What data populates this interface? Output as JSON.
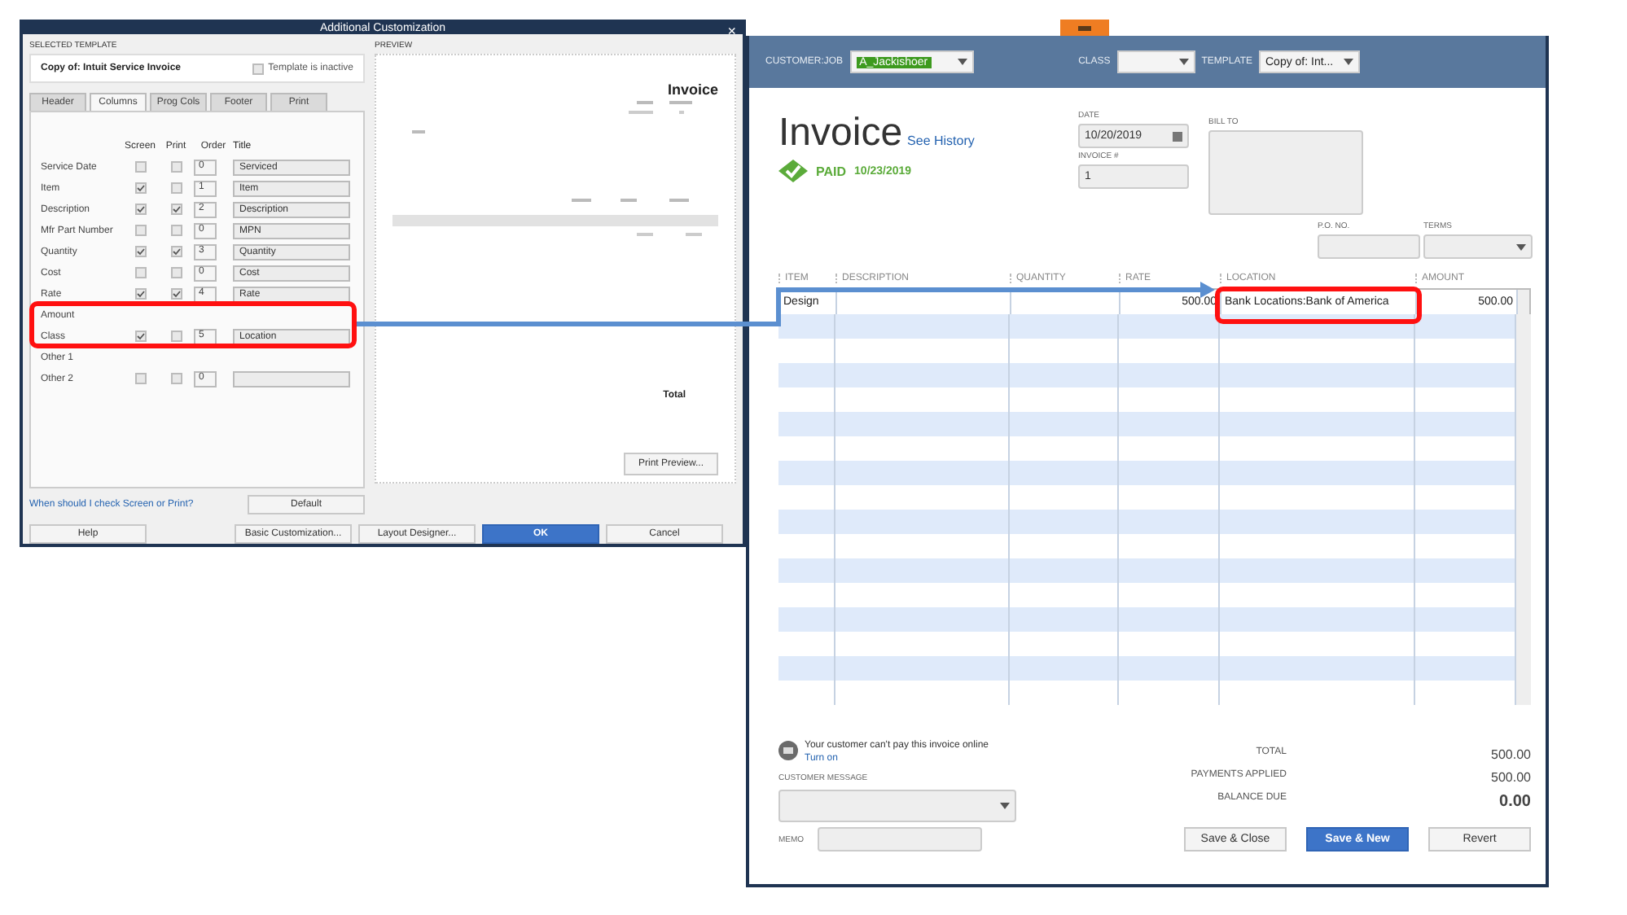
{
  "dialog": {
    "title": "Additional Customization",
    "close": "×",
    "selected_template_label": "SELECTED TEMPLATE",
    "template_name": "Copy of: Intuit Service Invoice",
    "inactive": {
      "label": "Template is inactive",
      "checked": false
    },
    "tabs": [
      {
        "label": "Header",
        "selected": false
      },
      {
        "label": "Columns",
        "selected": true
      },
      {
        "label": "Prog Cols",
        "selected": false
      },
      {
        "label": "Footer",
        "selected": false
      },
      {
        "label": "Print",
        "selected": false
      }
    ],
    "column_headers": [
      "Screen",
      "Print",
      "Order",
      "Title"
    ],
    "rows": [
      {
        "label": "Service Date",
        "screen": false,
        "print": false,
        "order": "0",
        "title": "Serviced"
      },
      {
        "label": "Item",
        "screen": true,
        "print": false,
        "order": "1",
        "title": "Item"
      },
      {
        "label": "Description",
        "screen": true,
        "print": true,
        "order": "2",
        "title": "Description"
      },
      {
        "label": "Mfr Part Number",
        "screen": false,
        "print": false,
        "order": "0",
        "title": "MPN"
      },
      {
        "label": "Quantity",
        "screen": true,
        "print": true,
        "order": "3",
        "title": "Quantity"
      },
      {
        "label": "Cost",
        "screen": false,
        "print": false,
        "order": "0",
        "title": "Cost"
      },
      {
        "label": "Rate",
        "screen": true,
        "print": true,
        "order": "4",
        "title": "Rate"
      },
      {
        "label": "Amount"
      },
      {
        "label": "Class",
        "screen": true,
        "print": false,
        "order": "5",
        "title": "Location"
      },
      {
        "label": "Other 1"
      },
      {
        "label": "Other 2",
        "screen": false,
        "print": false,
        "order": "0"
      }
    ],
    "help_link": "When should I check Screen or Print?",
    "default_button": "Default",
    "preview": {
      "label": "PREVIEW",
      "doc_title": "Invoice",
      "total_label": "Total",
      "button": "Print Preview..."
    },
    "buttons": [
      {
        "label": "Help",
        "primary": false
      },
      {
        "label": "Basic Customization...",
        "primary": false
      },
      {
        "label": "Layout Designer...",
        "primary": false
      },
      {
        "label": "OK",
        "primary": true
      },
      {
        "label": "Cancel",
        "primary": false
      }
    ]
  },
  "invoice": {
    "customer_label": "CUSTOMER:JOB",
    "customer": "A_Jackishoer",
    "class_label": "CLASS",
    "template_label": "TEMPLATE",
    "template": "Copy of: Int...",
    "title": "Invoice",
    "history_link": "See History",
    "paid_label": "PAID",
    "paid_date": "10/23/2019",
    "date_label": "DATE",
    "date": "10/20/2019",
    "number_label": "INVOICE #",
    "number": "1",
    "bill_to_label": "BILL TO",
    "po_label": "P.O. NO.",
    "terms_label": "TERMS",
    "columns": [
      "ITEM",
      "DESCRIPTION",
      "QUANTITY",
      "RATE",
      "LOCATION",
      "AMOUNT"
    ],
    "rows": [
      {
        "item": "Design",
        "rate": "500.00",
        "location": "Bank Locations:Bank of America",
        "amount": "500.00"
      }
    ],
    "online_note": "Your customer can't pay this invoice online",
    "turn_on": "Turn on",
    "message_label": "CUSTOMER MESSAGE",
    "memo_label": "MEMO",
    "totals": [
      {
        "label": "TOTAL",
        "value": "500.00",
        "strong": false
      },
      {
        "label": "PAYMENTS APPLIED",
        "value": "500.00",
        "strong": false
      },
      {
        "label": "BALANCE DUE",
        "value": "0.00",
        "strong": true
      }
    ],
    "buttons": [
      {
        "label": "Save & Close",
        "primary": false
      },
      {
        "label": "Save & New",
        "primary": true
      },
      {
        "label": "Revert",
        "primary": false
      }
    ]
  }
}
